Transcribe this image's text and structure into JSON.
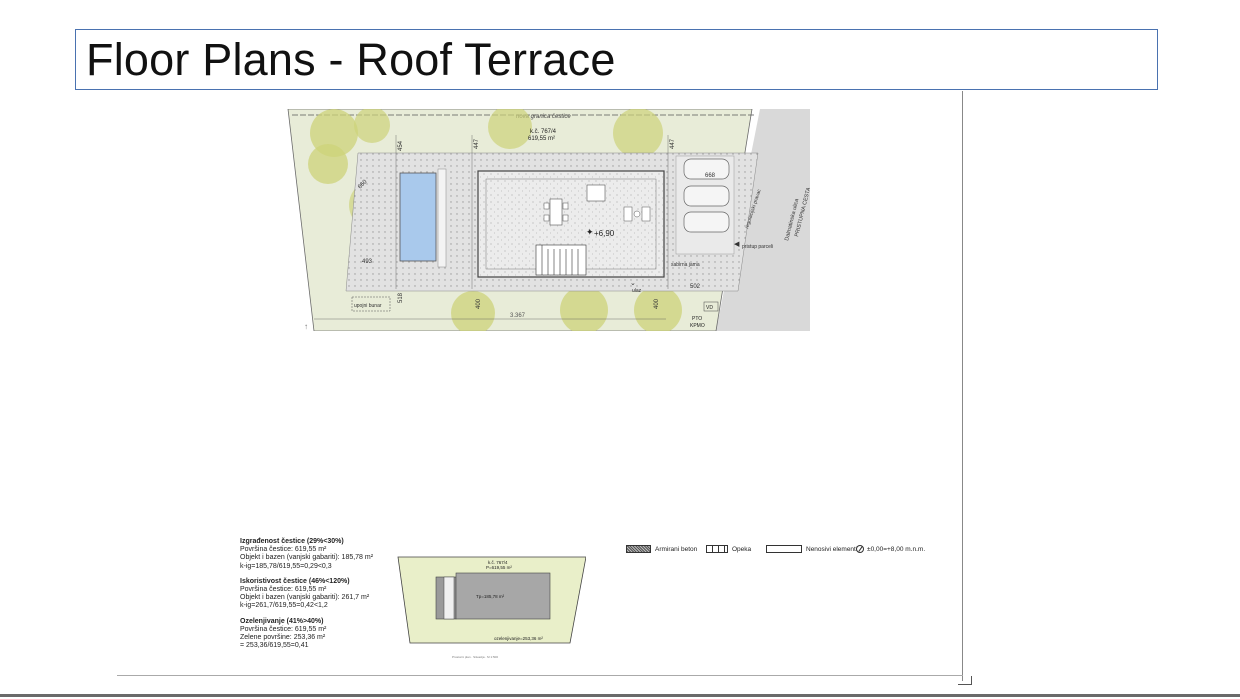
{
  "title": "Floor Plans  - Roof Terrace",
  "plan": {
    "boundary_label": "nova granica čestice",
    "parcel_label": "k.č. 767/4",
    "parcel_area": "619,55 m²",
    "dims": {
      "d454": "454",
      "d447a": "447",
      "d447b": "447",
      "d660": "660",
      "d668": "668",
      "d493": "493",
      "d518": "518",
      "d400a": "400",
      "d400b": "400",
      "d502": "502",
      "d3367": "3.367"
    },
    "level": "+6,90",
    "labels": {
      "upojni_bunar": "upojni bunar",
      "sabirna_jama": "sabirna jama",
      "ulaz": "ulaz",
      "regulacijski_pravac": "regulacijski pravac",
      "dalmatinska_ulica": "Dalmatinska ulica",
      "pristupna_cesta": "PRISTUPNA CESTA",
      "pristup_parceli": "pristup parceli",
      "vd": "VD",
      "pto": "PTO",
      "kpmo": "KPMO"
    }
  },
  "stats": {
    "block1": {
      "heading": "Izgrađenost čestice (29%<30%)",
      "line1": "Površina čestice: 619,55 m²",
      "line2": "Objekt i bazen (vanjski gabariti): 185,78 m²",
      "line3": "k-ig=185,78/619,55=0,29<0,3"
    },
    "block2": {
      "heading": "Iskoristivost čestice (46%<120%)",
      "line1": "Površina čestice: 619,55 m²",
      "line2": "Objekt i bazen (vanjski gabariti): 261,7 m²",
      "line3": "k-ig=261,7/619,55=0,42<1,2"
    },
    "block3": {
      "heading": "Ozelenjivanje (41%>40%)",
      "line1": "Površina čestice: 619,55 m²",
      "line2": "Zelene površine: 253,36 m²",
      "line3": "= 253,36/619,55=0,41"
    }
  },
  "mini_plan": {
    "parcel_label": "k.č. 767/4",
    "parcel_area": "P=619,55 m²",
    "footprint": "Tp=185,78 m²",
    "green": "ozelenjivanje=253,36 m²",
    "note": "Prostorni plan · Situacija · M 1:500"
  },
  "legend": {
    "beton": "Armirani beton",
    "opeka": "Opeka",
    "nenosivi": "Nenosivi elementi",
    "level": "±0,00=+8,00 m.n.m."
  },
  "colors": {
    "title_border": "#4a72b0",
    "green_area": "#e8ecd8",
    "tree": "#cdd37a",
    "road": "#d9d9d9",
    "pool": "#a9c9ec"
  }
}
